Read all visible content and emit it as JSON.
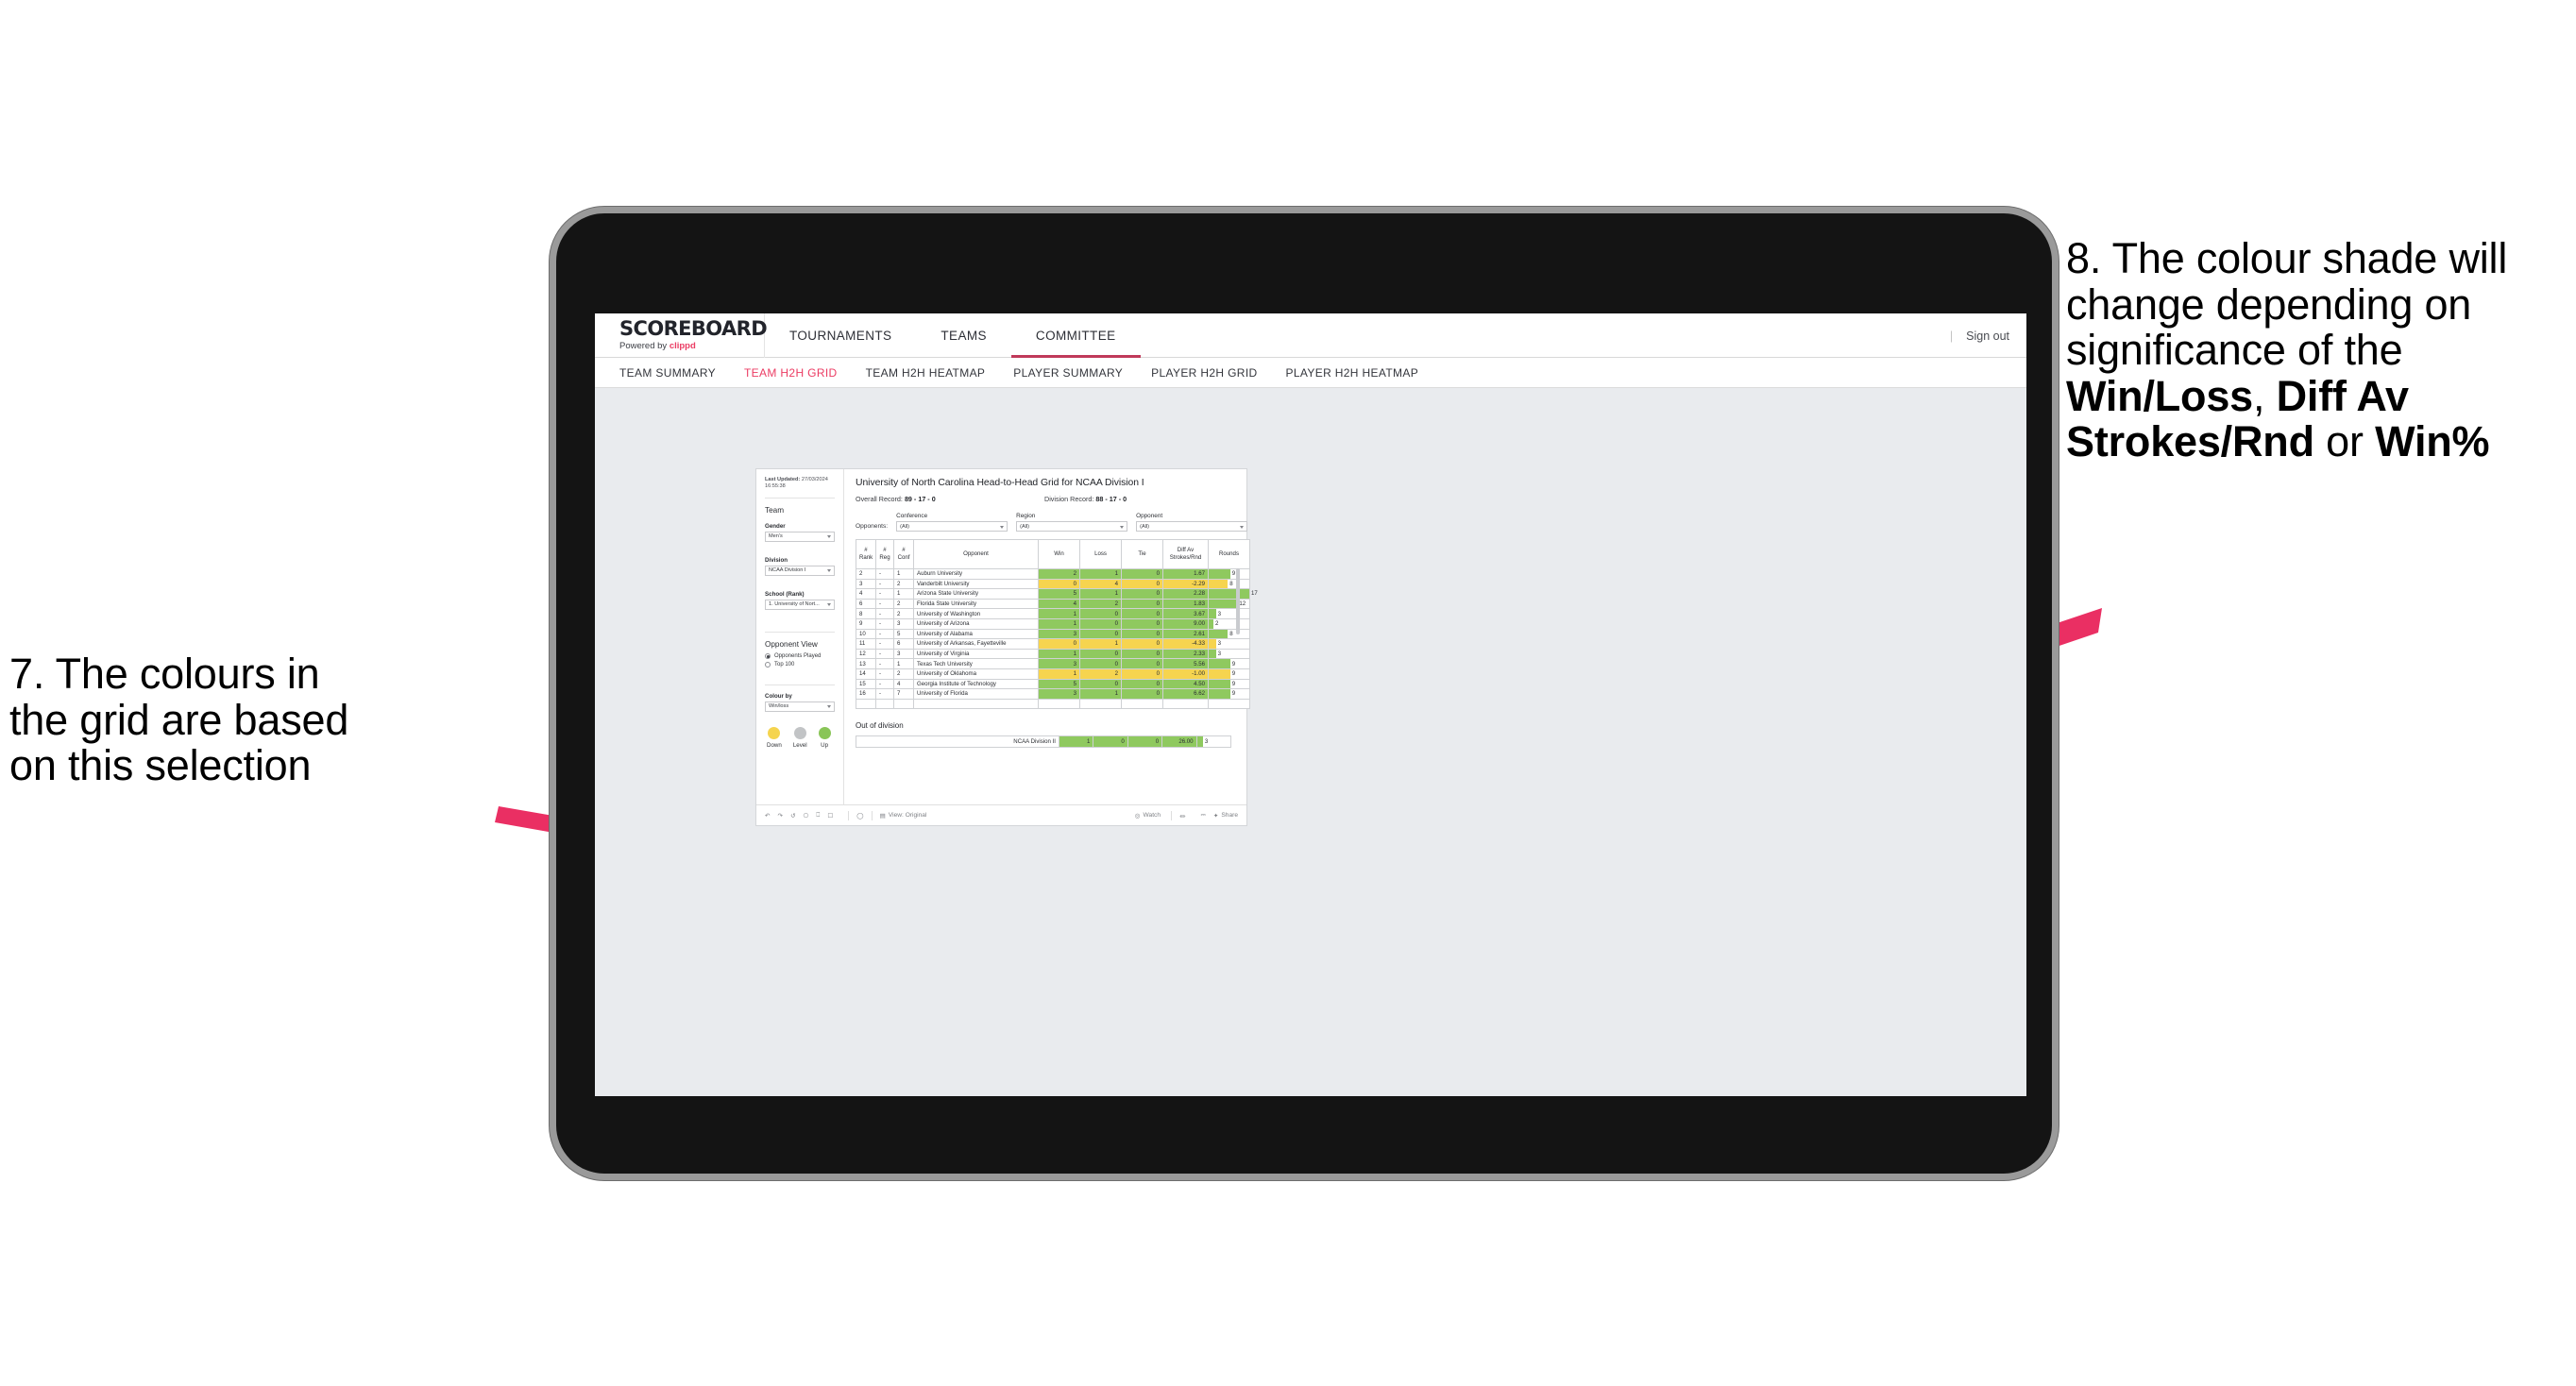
{
  "annotations": {
    "left": {
      "lines": [
        "7. The colours in",
        "the grid are based",
        "on this selection"
      ]
    },
    "right": {
      "pre": "8. The colour shade will change depending on significance of the ",
      "bold1": "Win/Loss",
      "mid1": ", ",
      "bold2": "Diff Av Strokes/Rnd",
      "mid2": " or ",
      "bold3": "Win%"
    }
  },
  "app": {
    "brand": {
      "title": "SCOREBOARD",
      "powered_prefix": "Powered by ",
      "powered_accent": "clippd"
    },
    "topnav": [
      {
        "label": "TOURNAMENTS",
        "active": false
      },
      {
        "label": "TEAMS",
        "active": false
      },
      {
        "label": "COMMITTEE",
        "active": true
      }
    ],
    "header_right": {
      "divider": "|",
      "sign_out": "Sign out"
    },
    "subnav": [
      {
        "label": "TEAM SUMMARY",
        "active": false
      },
      {
        "label": "TEAM H2H GRID",
        "active": true
      },
      {
        "label": "TEAM H2H HEATMAP",
        "active": false
      },
      {
        "label": "PLAYER SUMMARY",
        "active": false
      },
      {
        "label": "PLAYER H2H GRID",
        "active": false
      },
      {
        "label": "PLAYER H2H HEATMAP",
        "active": false
      }
    ]
  },
  "filters": {
    "last_updated_label": "Last Updated:",
    "last_updated_value": " 27/03/2024 16:55:38",
    "team_heading": "Team",
    "gender_label": "Gender",
    "gender_value": "Men's",
    "division_label": "Division",
    "division_value": "NCAA Division I",
    "school_label": "School (Rank)",
    "school_value": "1. University of Nort...",
    "opponent_view_heading": "Opponent View",
    "opponent_view_options": [
      {
        "label": "Opponents Played",
        "selected": true
      },
      {
        "label": "Top 100",
        "selected": false
      }
    ],
    "colour_by_label": "Colour by",
    "colour_by_value": "Win/loss",
    "legend": [
      {
        "label": "Down",
        "color": "#f5d44e"
      },
      {
        "label": "Level",
        "color": "#c2c4c6"
      },
      {
        "label": "Up",
        "color": "#89c557"
      }
    ]
  },
  "viz": {
    "title": "University of North Carolina Head-to-Head Grid for NCAA Division I",
    "overall_record_label": "Overall Record: ",
    "overall_record_value": "89 - 17 - 0",
    "division_record_label": "Division Record: ",
    "division_record_value": "88 - 17 - 0",
    "opponents_word": "Opponents:",
    "opponent_filters": [
      {
        "label": "Conference",
        "value": "(All)"
      },
      {
        "label": "Region",
        "value": "(All)"
      },
      {
        "label": "Opponent",
        "value": "(All)"
      }
    ],
    "out_of_division_title": "Out of division"
  },
  "chart_data": {
    "type": "table",
    "title": "University of North Carolina Head-to-Head Grid for NCAA Division I",
    "columns": [
      "# Rank",
      "# Reg",
      "# Conf",
      "Opponent",
      "Win",
      "Loss",
      "Tie",
      "Diff Av Strokes/Rnd",
      "Rounds"
    ],
    "column_header_lines": [
      [
        "#",
        "Rank"
      ],
      [
        "#",
        "Reg"
      ],
      [
        "#",
        "Conf"
      ],
      [
        "Opponent"
      ],
      [
        "Win"
      ],
      [
        "Loss"
      ],
      [
        "Tie"
      ],
      [
        "Diff Av",
        "Strokes/Rnd"
      ],
      [
        "Rounds"
      ]
    ],
    "rows": [
      {
        "rank": "2",
        "reg": "-",
        "conf": "1",
        "opponent": "Auburn University",
        "win": "2",
        "loss": "1",
        "tie": "0",
        "diff": "1.67",
        "rounds": "9",
        "rounds_num": 9,
        "color": "up"
      },
      {
        "rank": "3",
        "reg": "-",
        "conf": "2",
        "opponent": "Vanderbilt University",
        "win": "0",
        "loss": "4",
        "tie": "0",
        "diff": "-2.29",
        "rounds": "8",
        "rounds_num": 8,
        "color": "down"
      },
      {
        "rank": "4",
        "reg": "-",
        "conf": "1",
        "opponent": "Arizona State University",
        "win": "5",
        "loss": "1",
        "tie": "0",
        "diff": "2.28",
        "rounds": "17",
        "rounds_num": 17,
        "color": "up"
      },
      {
        "rank": "6",
        "reg": "-",
        "conf": "2",
        "opponent": "Florida State University",
        "win": "4",
        "loss": "2",
        "tie": "0",
        "diff": "1.83",
        "rounds": "12",
        "rounds_num": 12,
        "color": "up"
      },
      {
        "rank": "8",
        "reg": "-",
        "conf": "2",
        "opponent": "University of Washington",
        "win": "1",
        "loss": "0",
        "tie": "0",
        "diff": "3.67",
        "rounds": "3",
        "rounds_num": 3,
        "color": "up"
      },
      {
        "rank": "9",
        "reg": "-",
        "conf": "3",
        "opponent": "University of Arizona",
        "win": "1",
        "loss": "0",
        "tie": "0",
        "diff": "9.00",
        "rounds": "2",
        "rounds_num": 2,
        "color": "up"
      },
      {
        "rank": "10",
        "reg": "-",
        "conf": "5",
        "opponent": "University of Alabama",
        "win": "3",
        "loss": "0",
        "tie": "0",
        "diff": "2.61",
        "rounds": "8",
        "rounds_num": 8,
        "color": "up"
      },
      {
        "rank": "11",
        "reg": "-",
        "conf": "6",
        "opponent": "University of Arkansas, Fayetteville",
        "win": "0",
        "loss": "1",
        "tie": "0",
        "diff": "-4.33",
        "rounds": "3",
        "rounds_num": 3,
        "color": "down"
      },
      {
        "rank": "12",
        "reg": "-",
        "conf": "3",
        "opponent": "University of Virginia",
        "win": "1",
        "loss": "0",
        "tie": "0",
        "diff": "2.33",
        "rounds": "3",
        "rounds_num": 3,
        "color": "up"
      },
      {
        "rank": "13",
        "reg": "-",
        "conf": "1",
        "opponent": "Texas Tech University",
        "win": "3",
        "loss": "0",
        "tie": "0",
        "diff": "5.56",
        "rounds": "9",
        "rounds_num": 9,
        "color": "up"
      },
      {
        "rank": "14",
        "reg": "-",
        "conf": "2",
        "opponent": "University of Oklahoma",
        "win": "1",
        "loss": "2",
        "tie": "0",
        "diff": "-1.00",
        "rounds": "9",
        "rounds_num": 9,
        "color": "down"
      },
      {
        "rank": "15",
        "reg": "-",
        "conf": "4",
        "opponent": "Georgia Institute of Technology",
        "win": "5",
        "loss": "0",
        "tie": "0",
        "diff": "4.50",
        "rounds": "9",
        "rounds_num": 9,
        "color": "up"
      },
      {
        "rank": "16",
        "reg": "-",
        "conf": "7",
        "opponent": "University of Florida",
        "win": "3",
        "loss": "1",
        "tie": "0",
        "diff": "6.62",
        "rounds": "9",
        "rounds_num": 9,
        "color": "up"
      }
    ],
    "out_of_division_rows": [
      {
        "opponent": "NCAA Division II",
        "win": "1",
        "loss": "0",
        "tie": "0",
        "diff": "26.00",
        "rounds": "3",
        "rounds_num": 3,
        "color": "up"
      }
    ],
    "colors": {
      "up": "#8fc95f",
      "down": "#f6d44f",
      "level": "#c2c4c6"
    },
    "rounds_max": 17
  },
  "toolbar": {
    "view_label": "View: Original",
    "watch_label": "Watch",
    "share_label": "Share"
  },
  "theme": {
    "accent": "#eb3c63",
    "arrow": "#ea2f63",
    "up": "#8fc95f",
    "down": "#f6d44f",
    "level": "#c2c4c6"
  }
}
